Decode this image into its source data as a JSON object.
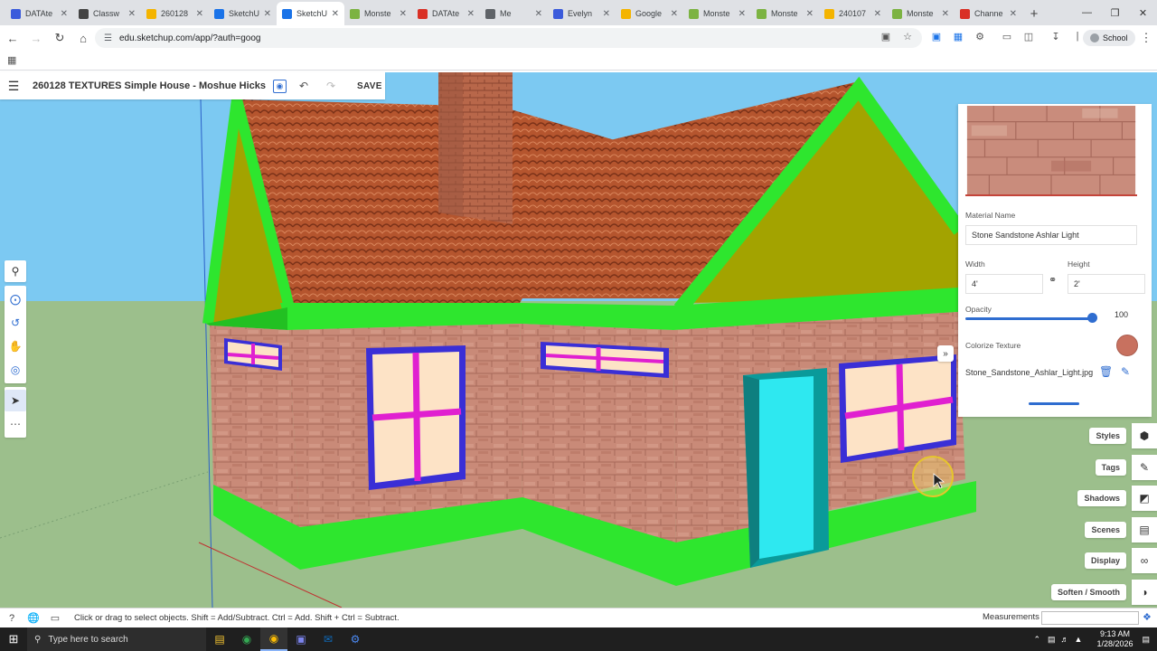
{
  "browser": {
    "tabs": [
      {
        "label": "DATAte",
        "color": "#3b5bdb",
        "active": false
      },
      {
        "label": "Classw",
        "color": "#444444",
        "active": false
      },
      {
        "label": "260128",
        "color": "#f4b400",
        "active": false
      },
      {
        "label": "SketchU",
        "color": "#1a73e8",
        "active": false
      },
      {
        "label": "SketchU",
        "color": "#1a73e8",
        "active": true
      },
      {
        "label": "Monste",
        "color": "#7cb342",
        "active": false
      },
      {
        "label": "DATAte",
        "color": "#d93025",
        "active": false
      },
      {
        "label": "Me",
        "color": "#5f6368",
        "active": false
      },
      {
        "label": "Evelyn",
        "color": "#3b5bdb",
        "active": false
      },
      {
        "label": "Google",
        "color": "#f4b400",
        "active": false
      },
      {
        "label": "Monste",
        "color": "#7cb342",
        "active": false
      },
      {
        "label": "Monste",
        "color": "#7cb342",
        "active": false
      },
      {
        "label": "240107",
        "color": "#f4b400",
        "active": false
      },
      {
        "label": "Monste",
        "color": "#7cb342",
        "active": false
      },
      {
        "label": "Channe",
        "color": "#d93025",
        "active": false
      }
    ],
    "url": "edu.sketchup.com/app/?auth=goog",
    "profile_label": "School"
  },
  "app": {
    "model_title": "260128 TEXTURES Simple House - Moshue Hicks",
    "save_label": "SAVE"
  },
  "material": {
    "name_label": "Material Name",
    "name_value": "Stone Sandstone Ashlar Light",
    "width_label": "Width",
    "width_value": "4'",
    "height_label": "Height",
    "height_value": "2'",
    "opacity_label": "Opacity",
    "opacity_value": "100",
    "colorize_label": "Colorize Texture",
    "colorize_color": "#c8715f",
    "filename": "Stone_Sandstone_Ashlar_Light.jpg"
  },
  "tray": {
    "items": [
      {
        "label": "Styles",
        "icon": "styles-icon"
      },
      {
        "label": "Tags",
        "icon": "tags-icon"
      },
      {
        "label": "Shadows",
        "icon": "shadows-icon"
      },
      {
        "label": "Scenes",
        "icon": "scenes-icon"
      },
      {
        "label": "Display",
        "icon": "display-icon"
      },
      {
        "label": "Soften / Smooth",
        "icon": "soften-icon"
      }
    ]
  },
  "status": {
    "hint": "Click or drag to select objects. Shift = Add/Subtract. Ctrl = Add. Shift + Ctrl = Subtract.",
    "measurements_label": "Measurements"
  },
  "taskbar": {
    "search_placeholder": "Type here to search",
    "time": "9:13 AM",
    "date": "1/28/2026"
  },
  "colors": {
    "sky": "#7cc9f2",
    "ground": "#9cbf8c",
    "trim": "#2ee62e",
    "gable": "#a3a300",
    "roof": "#b5552e",
    "brick_wall": "#c88a78",
    "window_frame": "#3a2fd6",
    "window_mullion": "#e020d0",
    "door": "#2ee8f0",
    "door_frame": "#0a9a9a",
    "accent": "#2f6dd0"
  }
}
